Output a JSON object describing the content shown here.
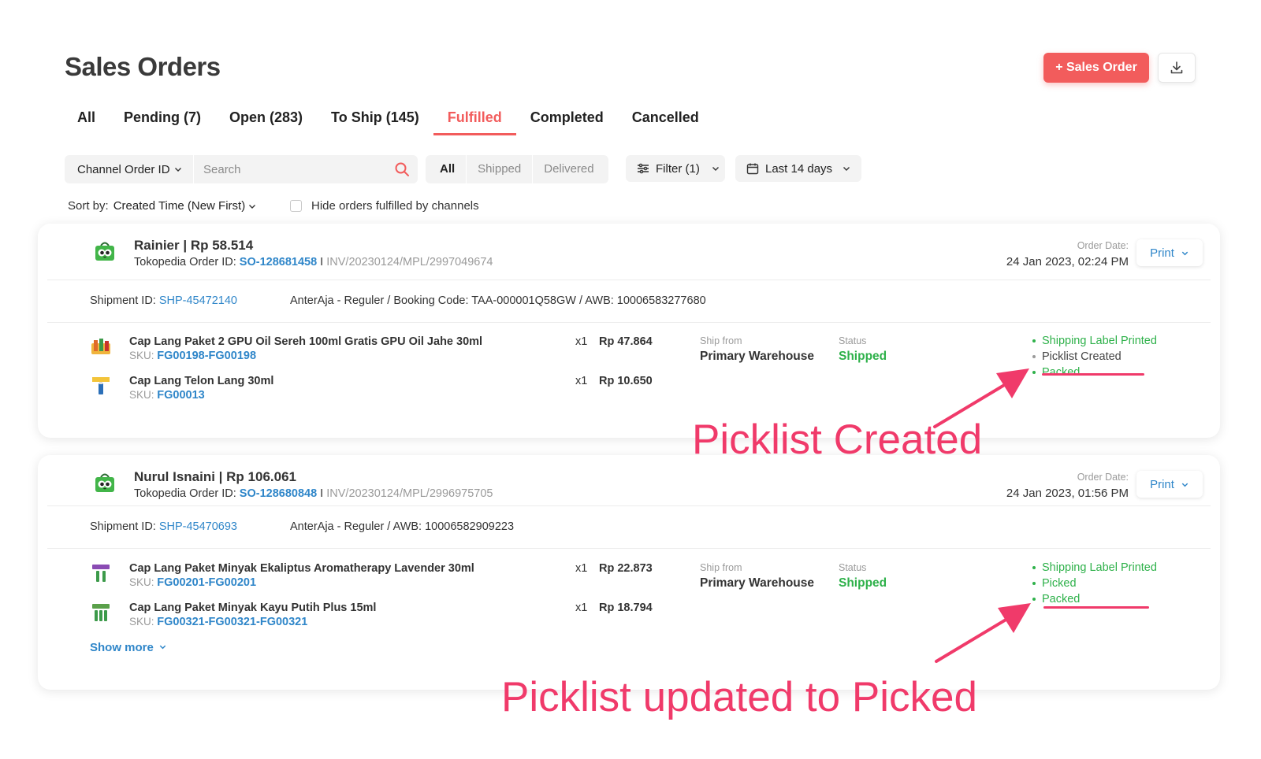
{
  "header": {
    "title": "Sales Orders",
    "add_button": "+ Sales Order"
  },
  "tabs": [
    {
      "label": "All"
    },
    {
      "label": "Pending (7)"
    },
    {
      "label": "Open (283)"
    },
    {
      "label": "To Ship (145)"
    },
    {
      "label": "Fulfilled",
      "active": true
    },
    {
      "label": "Completed"
    },
    {
      "label": "Cancelled"
    }
  ],
  "toolbar": {
    "channel_select": "Channel Order ID",
    "search_placeholder": "Search",
    "segments": [
      "All",
      "Shipped",
      "Delivered"
    ],
    "filter_label": "Filter (1)",
    "date_label": "Last 14 days",
    "sort_label": "Sort by:",
    "sort_value": "Created Time (New First)",
    "hide_label": "Hide orders fulfilled by channels"
  },
  "colors": {
    "accent": "#f25c5c",
    "link": "#2f86c9",
    "success": "#2eb14a",
    "annotation": "#f03a6a"
  },
  "orders": [
    {
      "buyer": "Rainier | Rp 58.514",
      "channel_prefix": "Tokopedia Order ID: ",
      "so_id": "SO-128681458",
      "sep": " I ",
      "invoice": "INV/20230124/MPL/2997049674",
      "order_date_label": "Order Date:",
      "order_date": "24 Jan 2023, 02:24 PM",
      "print_label": "Print",
      "shipment_label": "Shipment ID: ",
      "shipment_id": "SHP-45472140",
      "courier": "AnterAja - Reguler / Booking Code: TAA-000001Q58GW / AWB: 10006583277680",
      "items": [
        {
          "name": "Cap Lang Paket 2 GPU Oil Sereh 100ml Gratis GPU Oil Jahe 30ml",
          "sku_label": "SKU: ",
          "sku": "FG00198-FG00198",
          "qty": "x1",
          "price": "Rp 47.864"
        },
        {
          "name": "Cap Lang Telon Lang 30ml",
          "sku_label": "SKU: ",
          "sku": "FG00013",
          "qty": "x1",
          "price": "Rp 10.650"
        }
      ],
      "ship_from_label": "Ship from",
      "ship_from": "Primary Warehouse",
      "status_label": "Status",
      "status": "Shipped",
      "steps": [
        "Shipping Label Printed",
        "Picklist Created",
        "Packed"
      ]
    },
    {
      "buyer": "Nurul Isnaini | Rp 106.061",
      "channel_prefix": "Tokopedia Order ID: ",
      "so_id": "SO-128680848",
      "sep": " I ",
      "invoice": "INV/20230124/MPL/2996975705",
      "order_date_label": "Order Date:",
      "order_date": "24 Jan 2023, 01:56 PM",
      "print_label": "Print",
      "shipment_label": "Shipment ID: ",
      "shipment_id": "SHP-45470693",
      "courier": "AnterAja - Reguler / AWB: 10006582909223",
      "items": [
        {
          "name": "Cap Lang Paket Minyak Ekaliptus Aromatherapy Lavender 30ml",
          "sku_label": "SKU: ",
          "sku": "FG00201-FG00201",
          "qty": "x1",
          "price": "Rp 22.873"
        },
        {
          "name": "Cap Lang Paket Minyak Kayu Putih Plus 15ml",
          "sku_label": "SKU: ",
          "sku": "FG00321-FG00321-FG00321",
          "qty": "x1",
          "price": "Rp 18.794"
        }
      ],
      "ship_from_label": "Ship from",
      "ship_from": "Primary Warehouse",
      "status_label": "Status",
      "status": "Shipped",
      "steps": [
        "Shipping Label Printed",
        "Picked",
        "Packed"
      ],
      "show_more": "Show more"
    }
  ],
  "annotations": {
    "first": "Picklist Created",
    "second": "Picklist updated to Picked"
  }
}
